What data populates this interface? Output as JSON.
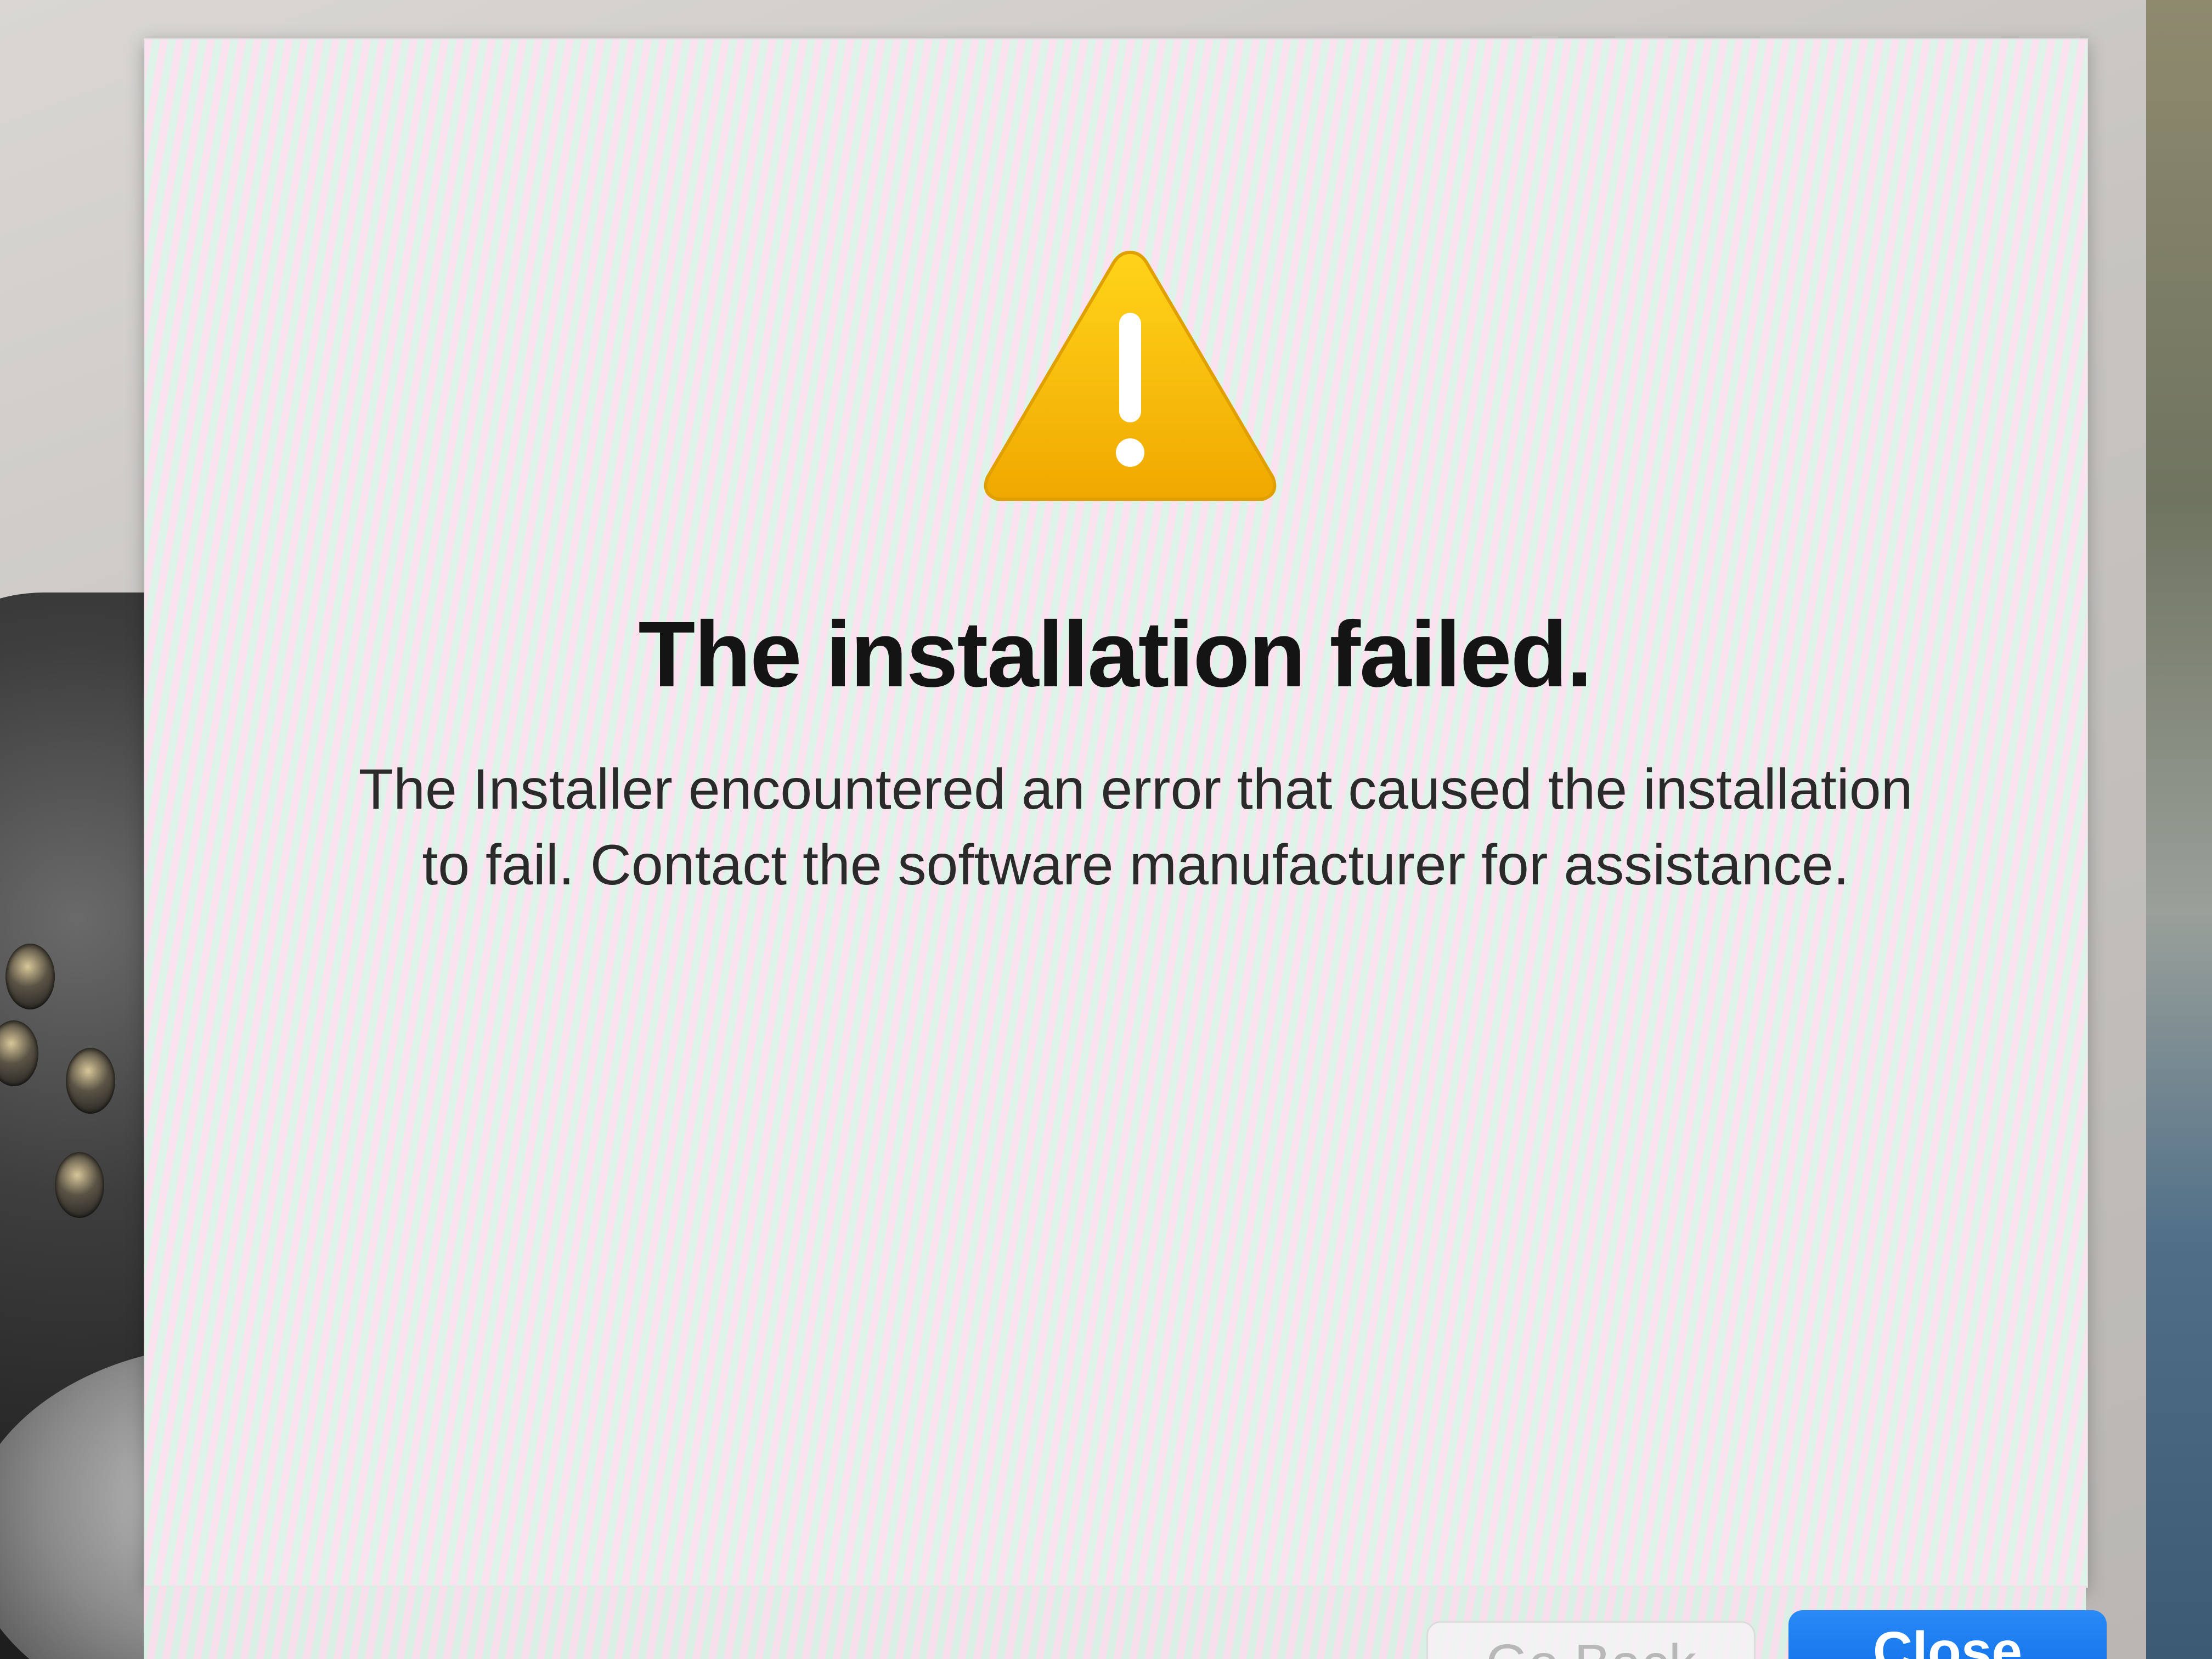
{
  "dialog": {
    "title": "The installation failed.",
    "message": "The Installer encountered an error that caused the installation to fail. Contact the software manufacturer for assistance.",
    "icon": "warning-triangle-icon",
    "accent_color": "#F5B800"
  },
  "buttons": {
    "back_label": "Go Back",
    "close_label": "Close",
    "close_color": "#0A6CE8"
  }
}
